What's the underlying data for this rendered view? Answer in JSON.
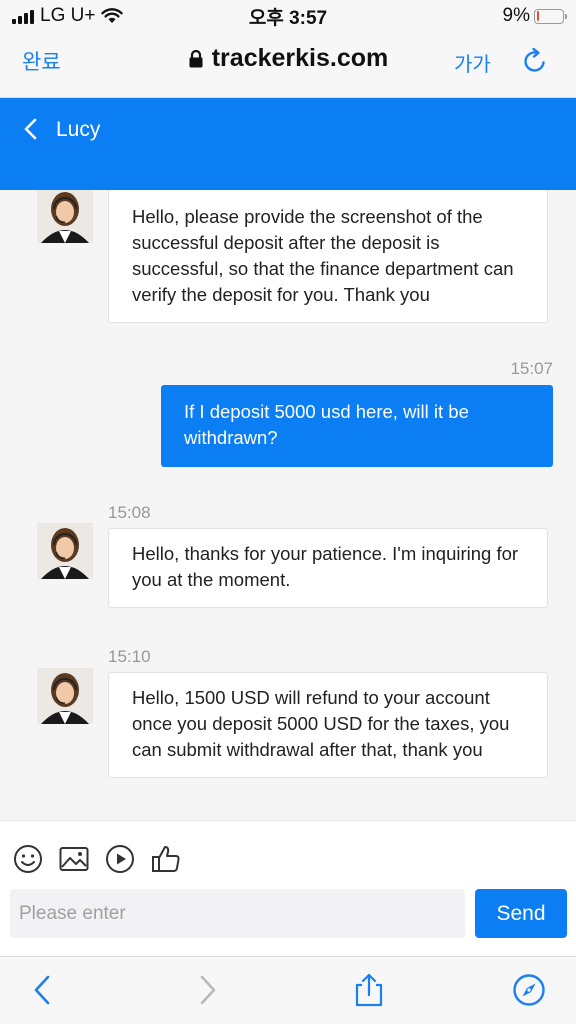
{
  "status_bar": {
    "carrier": "LG U+",
    "time": "오후 3:57",
    "battery_percent": "9%",
    "battery_level": 0.09,
    "battery_color": "#e74c3c"
  },
  "browser": {
    "done_label": "완료",
    "url": "trackerkis.com",
    "text_size_label": "가가",
    "icons": [
      "lock-icon",
      "reload-icon"
    ]
  },
  "chat_header": {
    "contact_name": "Lucy",
    "icon": "back-chevron-icon"
  },
  "messages": [
    {
      "direction": "incoming",
      "time": "",
      "text": "Hello, please provide the screenshot of the successful deposit after the deposit is successful, so that the finance department can verify the deposit for you. Thank you"
    },
    {
      "direction": "outgoing",
      "time": "15:07",
      "text": "If I deposit 5000 usd here, will it be withdrawn?"
    },
    {
      "direction": "incoming",
      "time": "15:08",
      "text": "Hello, thanks for your patience. I'm inquiring for you at the moment."
    },
    {
      "direction": "incoming",
      "time": "15:10",
      "text": "Hello, 1500 USD will refund to your account once you deposit 5000 USD for the taxes, you can submit withdrawal after that, thank you"
    }
  ],
  "toolbar": {
    "icons": [
      "emoji-icon",
      "image-icon",
      "video-icon",
      "thumbs-up-icon"
    ]
  },
  "composer": {
    "placeholder": "Please enter",
    "value": "",
    "send_label": "Send"
  },
  "safari_toolbar": {
    "icons": [
      "back-icon",
      "forward-icon",
      "share-icon",
      "compass-icon"
    ]
  },
  "colors": {
    "accent": "#0a7ef2",
    "link": "#1a7ff0",
    "background": "#f5f5f5"
  }
}
